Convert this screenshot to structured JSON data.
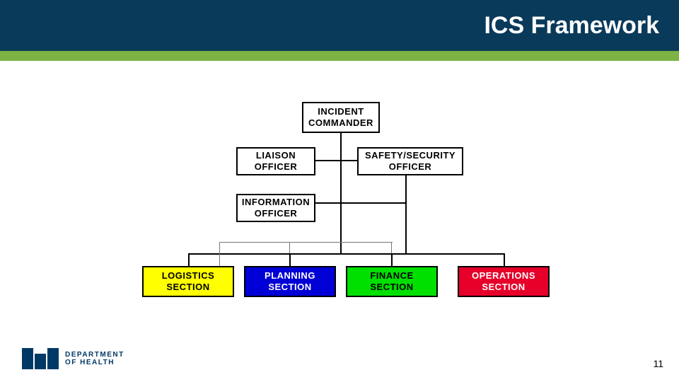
{
  "header": {
    "title": "ICS Framework"
  },
  "nodes": {
    "incident_commander": {
      "line1": "INCIDENT",
      "line2": "COMMANDER"
    },
    "liaison": {
      "line1": "LIAISON",
      "line2": "OFFICER"
    },
    "safety": {
      "line1": "SAFETY/SECURITY",
      "line2": "OFFICER"
    },
    "information": {
      "line1": "INFORMATION",
      "line2": "OFFICER"
    }
  },
  "sections": {
    "logistics": {
      "line1": "LOGISTICS",
      "line2": "SECTION",
      "bg": "#ffff00",
      "fg": "#000000"
    },
    "planning": {
      "line1": "PLANNING",
      "line2": "SECTION",
      "bg": "#0000d6",
      "fg": "#ffffff"
    },
    "finance": {
      "line1": "FINANCE",
      "line2": "SECTION",
      "bg": "#00e000",
      "fg": "#000000"
    },
    "operations": {
      "line1": "OPERATIONS",
      "line2": "SECTION",
      "bg": "#e6002a",
      "fg": "#ffffff"
    }
  },
  "footer": {
    "logo_text_line1": "DEPARTMENT",
    "logo_text_line2": "OF HEALTH",
    "page_number": "11"
  }
}
